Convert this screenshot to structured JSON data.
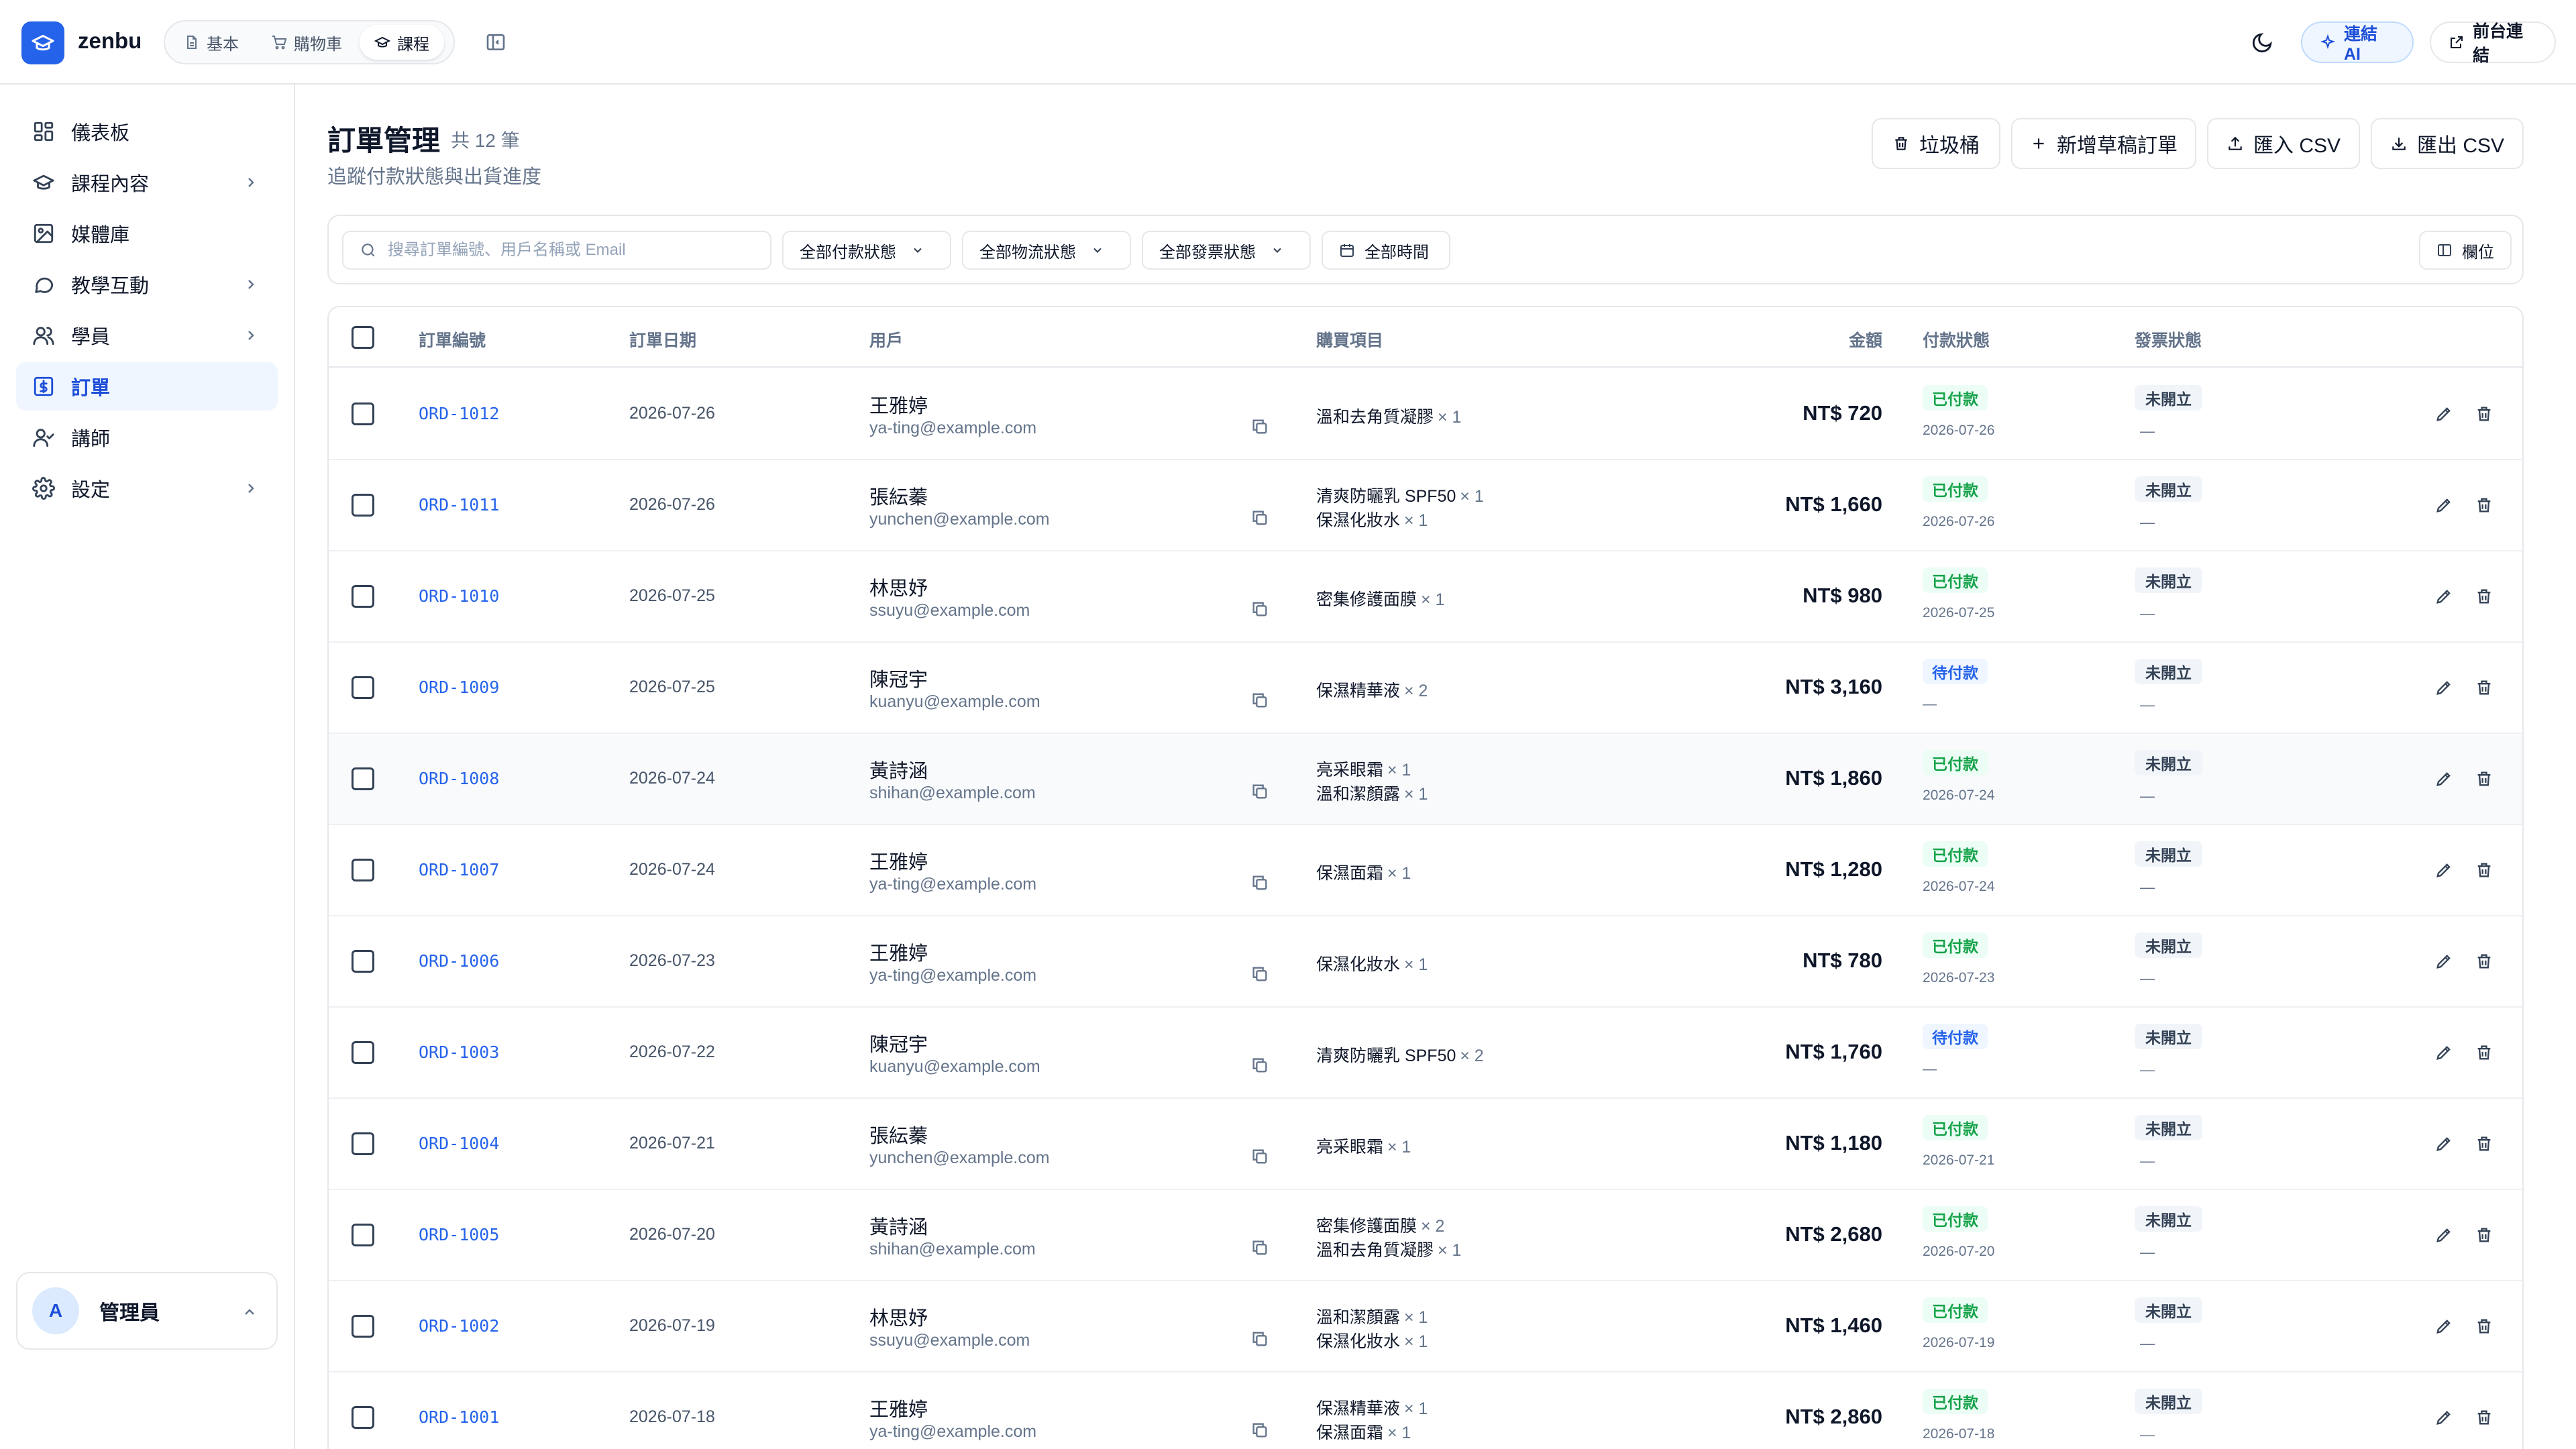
{
  "app": {
    "brand": "zenbu"
  },
  "mode_tabs": [
    {
      "label": "基本",
      "icon": "document-icon"
    },
    {
      "label": "購物車",
      "icon": "cart-icon"
    },
    {
      "label": "課程",
      "icon": "graduation-cap-icon",
      "active": true
    }
  ],
  "topbar": {
    "connect_ai": "連結 AI",
    "frontend_link": "前台連結"
  },
  "sidebar": {
    "items": [
      {
        "label": "儀表板",
        "icon": "dashboard-icon"
      },
      {
        "label": "課程內容",
        "icon": "graduation-cap-icon",
        "expandable": true
      },
      {
        "label": "媒體庫",
        "icon": "image-icon"
      },
      {
        "label": "教學互動",
        "icon": "chat-icon",
        "expandable": true
      },
      {
        "label": "學員",
        "icon": "users-icon",
        "expandable": true
      },
      {
        "label": "訂單",
        "icon": "dollar-icon",
        "active": true
      },
      {
        "label": "講師",
        "icon": "instructor-icon"
      },
      {
        "label": "設定",
        "icon": "gear-icon",
        "expandable": true
      }
    ],
    "user": {
      "avatar_letter": "A",
      "name": "管理員"
    }
  },
  "page": {
    "title": "訂單管理",
    "count": "共 12 筆",
    "subtitle": "追蹤付款狀態與出貨進度",
    "actions": {
      "trash": "垃圾桶",
      "new_draft": "新增草稿訂單",
      "import_csv": "匯入 CSV",
      "export_csv": "匯出 CSV"
    }
  },
  "filters": {
    "search_placeholder": "搜尋訂單編號、用戶名稱或 Email",
    "payment": "全部付款狀態",
    "shipping": "全部物流狀態",
    "invoice": "全部發票狀態",
    "time": "全部時間",
    "columns": "欄位"
  },
  "table": {
    "headers": {
      "order_id": "訂單編號",
      "date": "訂單日期",
      "user": "用戶",
      "items": "購買項目",
      "amount": "金額",
      "payment": "付款狀態",
      "invoice": "發票狀態"
    },
    "rows": [
      {
        "id": "ORD-1012",
        "date": "2026-07-26",
        "name": "王雅婷",
        "email": "ya-ting@example.com",
        "items": [
          {
            "name": "溫和去角質凝膠",
            "qty": "× 1"
          }
        ],
        "amount": "NT$ 720",
        "payment": "已付款",
        "payment_type": "paid",
        "payment_date": "2026-07-26",
        "invoice": "未開立",
        "invoice_sub": "—"
      },
      {
        "id": "ORD-1011",
        "date": "2026-07-26",
        "name": "張紜蓁",
        "email": "yunchen@example.com",
        "items": [
          {
            "name": "清爽防曬乳 SPF50",
            "qty": "× 1"
          },
          {
            "name": "保濕化妝水",
            "qty": "× 1"
          }
        ],
        "amount": "NT$ 1,660",
        "payment": "已付款",
        "payment_type": "paid",
        "payment_date": "2026-07-26",
        "invoice": "未開立",
        "invoice_sub": "—"
      },
      {
        "id": "ORD-1010",
        "date": "2026-07-25",
        "name": "林思妤",
        "email": "ssuyu@example.com",
        "items": [
          {
            "name": "密集修護面膜",
            "qty": "× 1"
          }
        ],
        "amount": "NT$ 980",
        "payment": "已付款",
        "payment_type": "paid",
        "payment_date": "2026-07-25",
        "invoice": "未開立",
        "invoice_sub": "—"
      },
      {
        "id": "ORD-1009",
        "date": "2026-07-25",
        "name": "陳冠宇",
        "email": "kuanyu@example.com",
        "items": [
          {
            "name": "保濕精華液",
            "qty": "× 2"
          }
        ],
        "amount": "NT$ 3,160",
        "payment": "待付款",
        "payment_type": "pending",
        "payment_date": "—",
        "invoice": "未開立",
        "invoice_sub": "—"
      },
      {
        "id": "ORD-1008",
        "date": "2026-07-24",
        "name": "黃詩涵",
        "email": "shihan@example.com",
        "items": [
          {
            "name": "亮采眼霜",
            "qty": "× 1"
          },
          {
            "name": "溫和潔顏露",
            "qty": "× 1"
          }
        ],
        "amount": "NT$ 1,860",
        "payment": "已付款",
        "payment_type": "paid",
        "payment_date": "2026-07-24",
        "invoice": "未開立",
        "invoice_sub": "—",
        "highlight": true
      },
      {
        "id": "ORD-1007",
        "date": "2026-07-24",
        "name": "王雅婷",
        "email": "ya-ting@example.com",
        "items": [
          {
            "name": "保濕面霜",
            "qty": "× 1"
          }
        ],
        "amount": "NT$ 1,280",
        "payment": "已付款",
        "payment_type": "paid",
        "payment_date": "2026-07-24",
        "invoice": "未開立",
        "invoice_sub": "—"
      },
      {
        "id": "ORD-1006",
        "date": "2026-07-23",
        "name": "王雅婷",
        "email": "ya-ting@example.com",
        "items": [
          {
            "name": "保濕化妝水",
            "qty": "× 1"
          }
        ],
        "amount": "NT$ 780",
        "payment": "已付款",
        "payment_type": "paid",
        "payment_date": "2026-07-23",
        "invoice": "未開立",
        "invoice_sub": "—"
      },
      {
        "id": "ORD-1003",
        "date": "2026-07-22",
        "name": "陳冠宇",
        "email": "kuanyu@example.com",
        "items": [
          {
            "name": "清爽防曬乳 SPF50",
            "qty": "× 2"
          }
        ],
        "amount": "NT$ 1,760",
        "payment": "待付款",
        "payment_type": "pending",
        "payment_date": "—",
        "invoice": "未開立",
        "invoice_sub": "—"
      },
      {
        "id": "ORD-1004",
        "date": "2026-07-21",
        "name": "張紜蓁",
        "email": "yunchen@example.com",
        "items": [
          {
            "name": "亮采眼霜",
            "qty": "× 1"
          }
        ],
        "amount": "NT$ 1,180",
        "payment": "已付款",
        "payment_type": "paid",
        "payment_date": "2026-07-21",
        "invoice": "未開立",
        "invoice_sub": "—"
      },
      {
        "id": "ORD-1005",
        "date": "2026-07-20",
        "name": "黃詩涵",
        "email": "shihan@example.com",
        "items": [
          {
            "name": "密集修護面膜",
            "qty": "× 2"
          },
          {
            "name": "溫和去角質凝膠",
            "qty": "× 1"
          }
        ],
        "amount": "NT$ 2,680",
        "payment": "已付款",
        "payment_type": "paid",
        "payment_date": "2026-07-20",
        "invoice": "未開立",
        "invoice_sub": "—"
      },
      {
        "id": "ORD-1002",
        "date": "2026-07-19",
        "name": "林思妤",
        "email": "ssuyu@example.com",
        "items": [
          {
            "name": "溫和潔顏露",
            "qty": "× 1"
          },
          {
            "name": "保濕化妝水",
            "qty": "× 1"
          }
        ],
        "amount": "NT$ 1,460",
        "payment": "已付款",
        "payment_type": "paid",
        "payment_date": "2026-07-19",
        "invoice": "未開立",
        "invoice_sub": "—"
      },
      {
        "id": "ORD-1001",
        "date": "2026-07-18",
        "name": "王雅婷",
        "email": "ya-ting@example.com",
        "items": [
          {
            "name": "保濕精華液",
            "qty": "× 1"
          },
          {
            "name": "保濕面霜",
            "qty": "× 1"
          }
        ],
        "amount": "NT$ 2,860",
        "payment": "已付款",
        "payment_type": "paid",
        "payment_date": "2026-07-18",
        "invoice": "未開立",
        "invoice_sub": "—"
      }
    ]
  },
  "colors": {
    "accent": "#2563eb",
    "paid": "#16a34a",
    "pending": "#2563eb",
    "border": "#e5e7eb"
  }
}
